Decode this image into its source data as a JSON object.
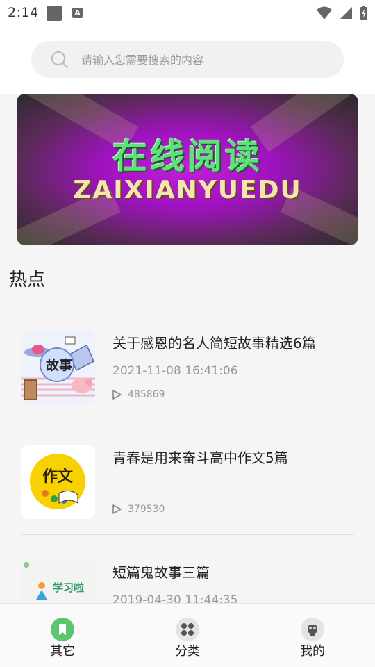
{
  "status_bar": {
    "time": "2:14",
    "a_badge": "A"
  },
  "search": {
    "placeholder": "请输入您需要搜索的内容"
  },
  "banner": {
    "title": "在线阅读",
    "subtitle": "ZAIXIANYUEDU"
  },
  "section": {
    "title": "热点"
  },
  "articles": [
    {
      "title": "关于感恩的名人简短故事精选6篇",
      "date": "2021-11-08 16:41:06",
      "views": "485869",
      "thumb_text": "故事"
    },
    {
      "title": "青春是用来奋斗高中作文5篇",
      "date": "",
      "views": "379530",
      "thumb_text": "作文"
    },
    {
      "title": "短篇鬼故事三篇",
      "date": "2019-04-30 11:44:35",
      "views": "",
      "thumb_text": "学习啦"
    }
  ],
  "bottom_nav": {
    "items": [
      {
        "label": "其它",
        "icon": "bookmark-icon",
        "active": true
      },
      {
        "label": "分类",
        "icon": "grid-icon",
        "active": false
      },
      {
        "label": "我的",
        "icon": "robot-icon",
        "active": false
      }
    ]
  },
  "colors": {
    "accent_green": "#5cc66e",
    "placeholder_gray": "#9a9a9a"
  }
}
